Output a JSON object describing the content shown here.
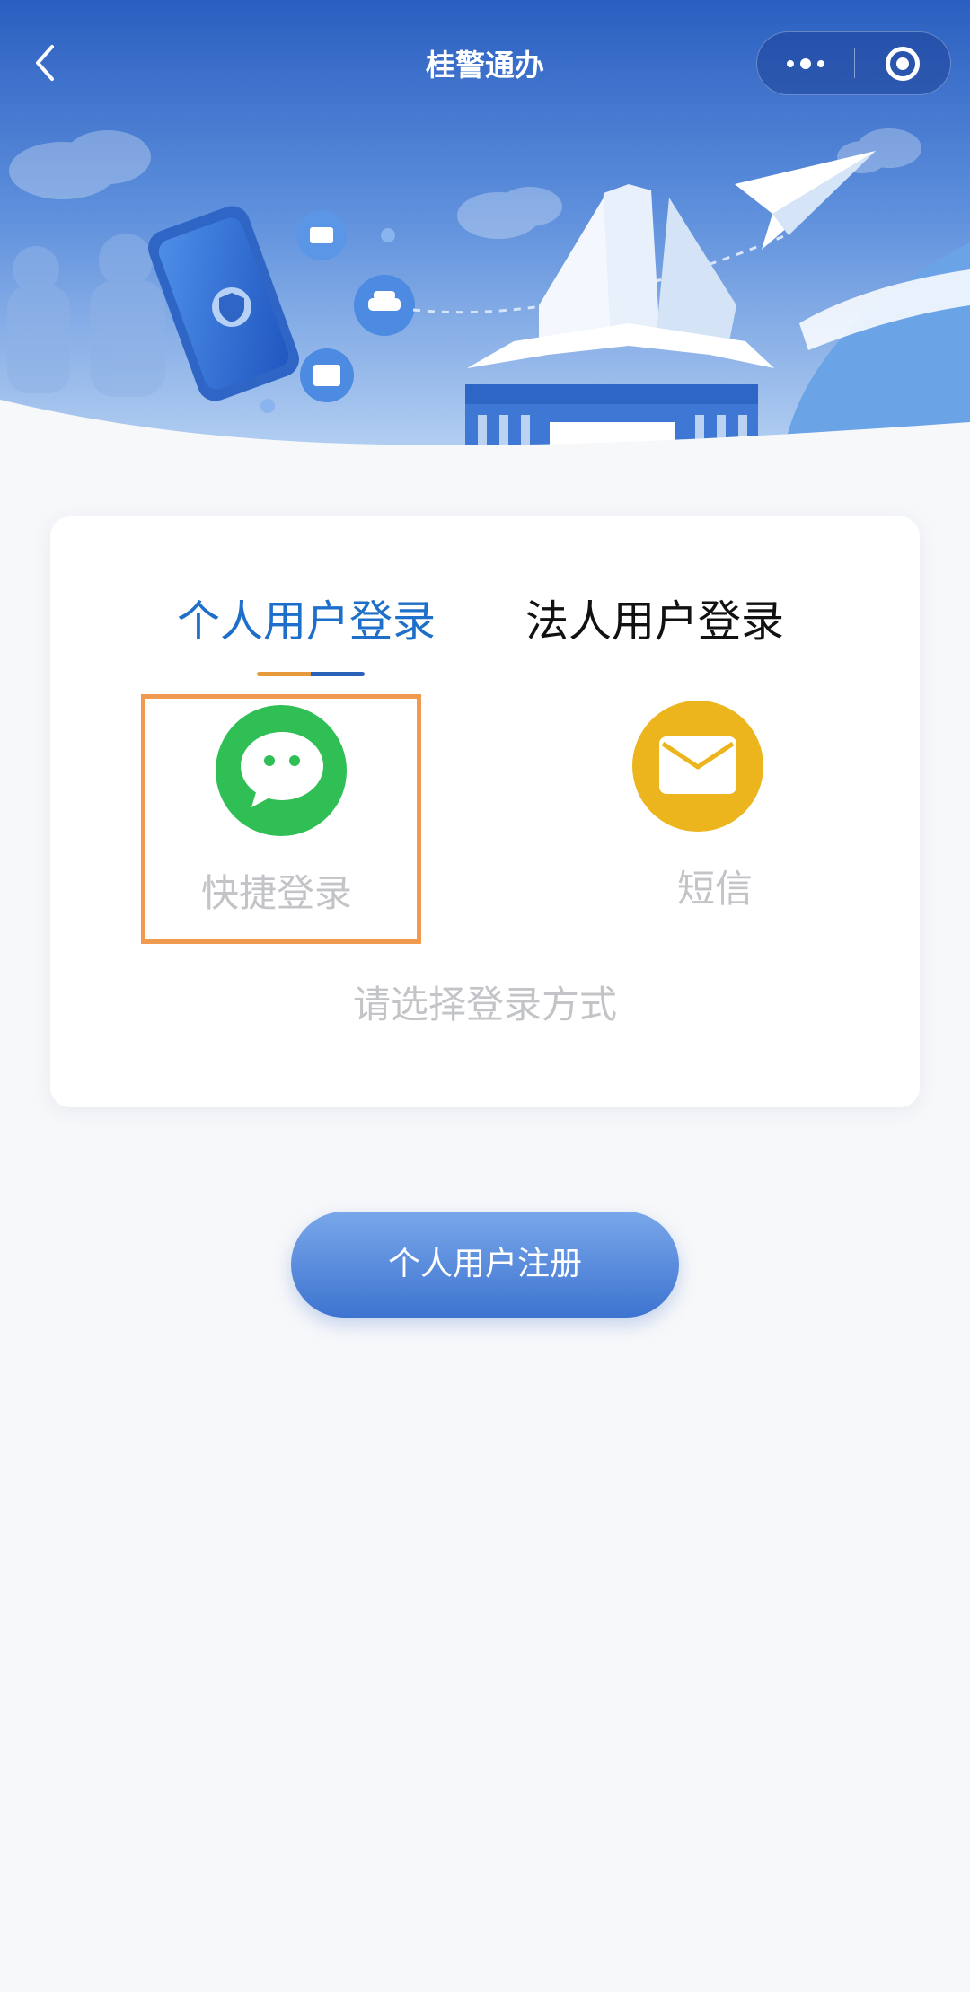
{
  "nav": {
    "title": "桂警通办",
    "back_icon": "chevron-left-icon",
    "more_icon": "more-dots-icon",
    "close_icon": "target-icon"
  },
  "banner": {
    "illustration_items": [
      "phone-shield-icon",
      "id-card-icon",
      "car-icon",
      "person-card-icon",
      "paper-plane-icon",
      "landmark-building"
    ],
    "colors": {
      "sky_top": "#2d63c2",
      "sky_bottom": "#aacbf1",
      "ground": "#f7f8fa"
    }
  },
  "login": {
    "tabs": [
      {
        "label": "个人用户登录",
        "active": true
      },
      {
        "label": "法人用户登录",
        "active": false
      }
    ],
    "methods": [
      {
        "label": "快捷登录",
        "icon": "wechat-icon",
        "color": "#2fbf55",
        "highlighted": true
      },
      {
        "label": "短信",
        "icon": "envelope-icon",
        "color": "#ecb51e",
        "highlighted": false
      }
    ],
    "hint": "请选择登录方式"
  },
  "register": {
    "label": "个人用户注册"
  },
  "colors": {
    "accent": "#1e6fc9",
    "highlight_box": "#ef9a4e",
    "tab_underline": [
      "#e79a3c",
      "#2b62b9"
    ]
  }
}
